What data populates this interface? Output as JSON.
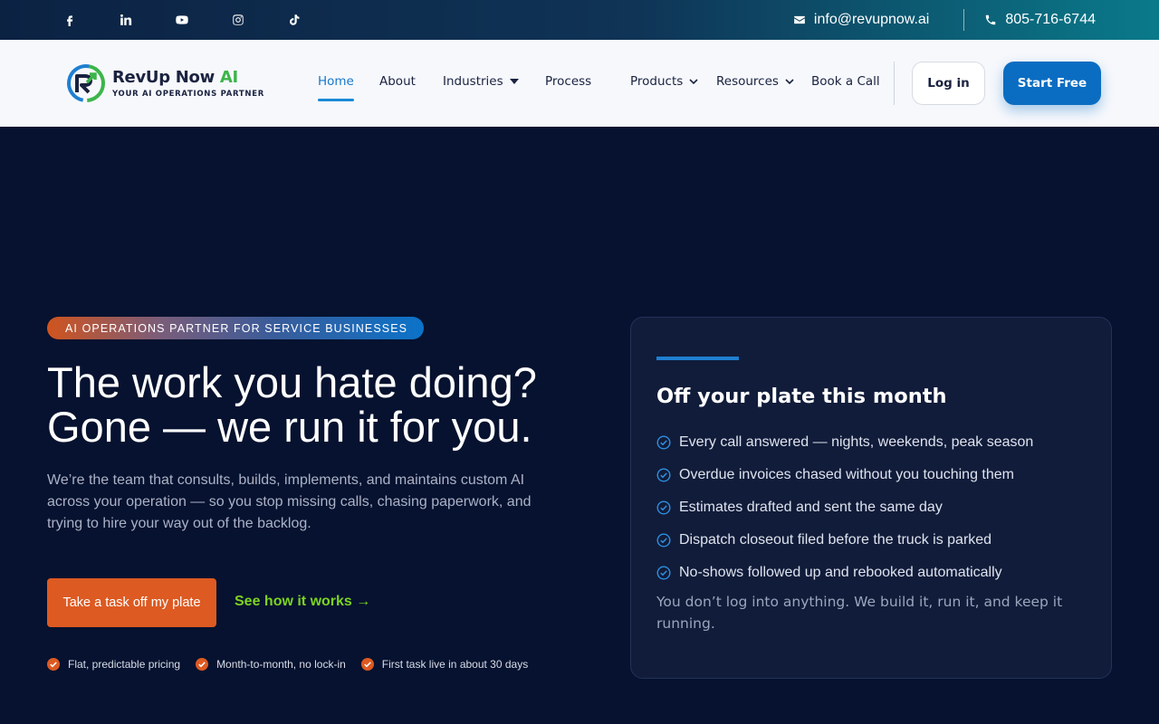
{
  "topbar": {
    "social": [
      {
        "icon": "facebook-icon"
      },
      {
        "icon": "linkedin-icon"
      },
      {
        "icon": "youtube-icon"
      },
      {
        "icon": "instagram-icon"
      },
      {
        "icon": "tiktok-icon"
      }
    ],
    "email": "info@revupnow.ai",
    "phone": "805-716-6744"
  },
  "nav": {
    "logo": {
      "name_part1": "RevUp Now ",
      "name_part2": "AI",
      "tagline": "YOUR AI OPERATIONS PARTNER"
    },
    "menu": [
      {
        "label": "Home",
        "active": true
      },
      {
        "label": "About"
      },
      {
        "label": "Industries",
        "dropdown": "caret"
      },
      {
        "label": "Process"
      },
      {
        "label": "Products",
        "dropdown": "chevron"
      },
      {
        "label": "Resources",
        "dropdown": "chevron"
      },
      {
        "label": "Book a Call"
      }
    ],
    "login_label": "Log in",
    "start_label": "Start Free"
  },
  "hero": {
    "badge": "AI OPERATIONS PARTNER FOR SERVICE BUSINESSES",
    "headline_line1": "The work you hate doing?",
    "headline_line2": "Gone — we run it for you.",
    "subtext": "We’re the team that consults, builds, implements, and maintains custom AI across your operation — so you stop missing calls, chasing paperwork, and trying to hire your way out of the backlog.",
    "cta_primary": "Take a task off my plate",
    "cta_link": "See how it works →",
    "perks": [
      "Flat, predictable pricing",
      "Month-to-month, no lock-in",
      "First task live in about 30 days"
    ]
  },
  "card": {
    "title": "Off your plate this month",
    "items": [
      "Every call answered — nights, weekends, peak season",
      "Overdue invoices chased without you touching them",
      "Estimates drafted and sent the same day",
      "Dispatch closeout filed before the truck is parked",
      "No-shows followed up and rebooked automatically"
    ],
    "footer": "You don’t log into anything. We build it, run it, and keep it running."
  },
  "colors": {
    "accent_blue": "#0a6dc2",
    "accent_orange": "#dd5a22",
    "accent_green": "#7cd321",
    "hero_bg": "#06122f"
  }
}
